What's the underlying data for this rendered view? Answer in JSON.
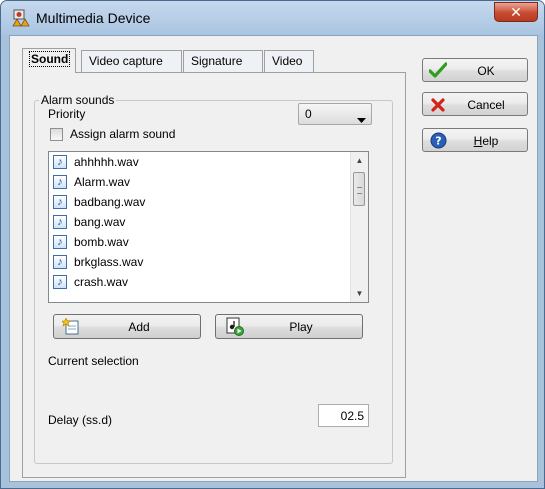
{
  "window": {
    "title": "Multimedia Device",
    "close_glyph": "✕",
    "icon": "multimedia-device-icon"
  },
  "tabs": [
    {
      "label": "Sound",
      "active": true
    },
    {
      "label": "Video capture",
      "active": false
    },
    {
      "label": "Signature",
      "active": false
    },
    {
      "label": "Video",
      "active": false
    }
  ],
  "alarm_group": {
    "label": "Alarm sounds",
    "priority_label": "Priority",
    "priority_value": "0",
    "assign_label": "Assign alarm sound",
    "assign_checked": false,
    "sound_files": [
      "ahhhhh.wav",
      "Alarm.wav",
      "badbang.wav",
      "bang.wav",
      "bomb.wav",
      "brkglass.wav",
      "crash.wav"
    ],
    "add_label": "Add",
    "play_label": "Play",
    "current_selection_label": "Current selection",
    "delay_label": "Delay (ss.d)",
    "delay_value": "02.5"
  },
  "side_buttons": {
    "ok_label": "OK",
    "cancel_label": "Cancel",
    "help_label": "Help"
  },
  "colors": {
    "ok_check": "#2f9e1f",
    "cancel_x": "#d2231a",
    "help_blue": "#2b5fb6"
  }
}
